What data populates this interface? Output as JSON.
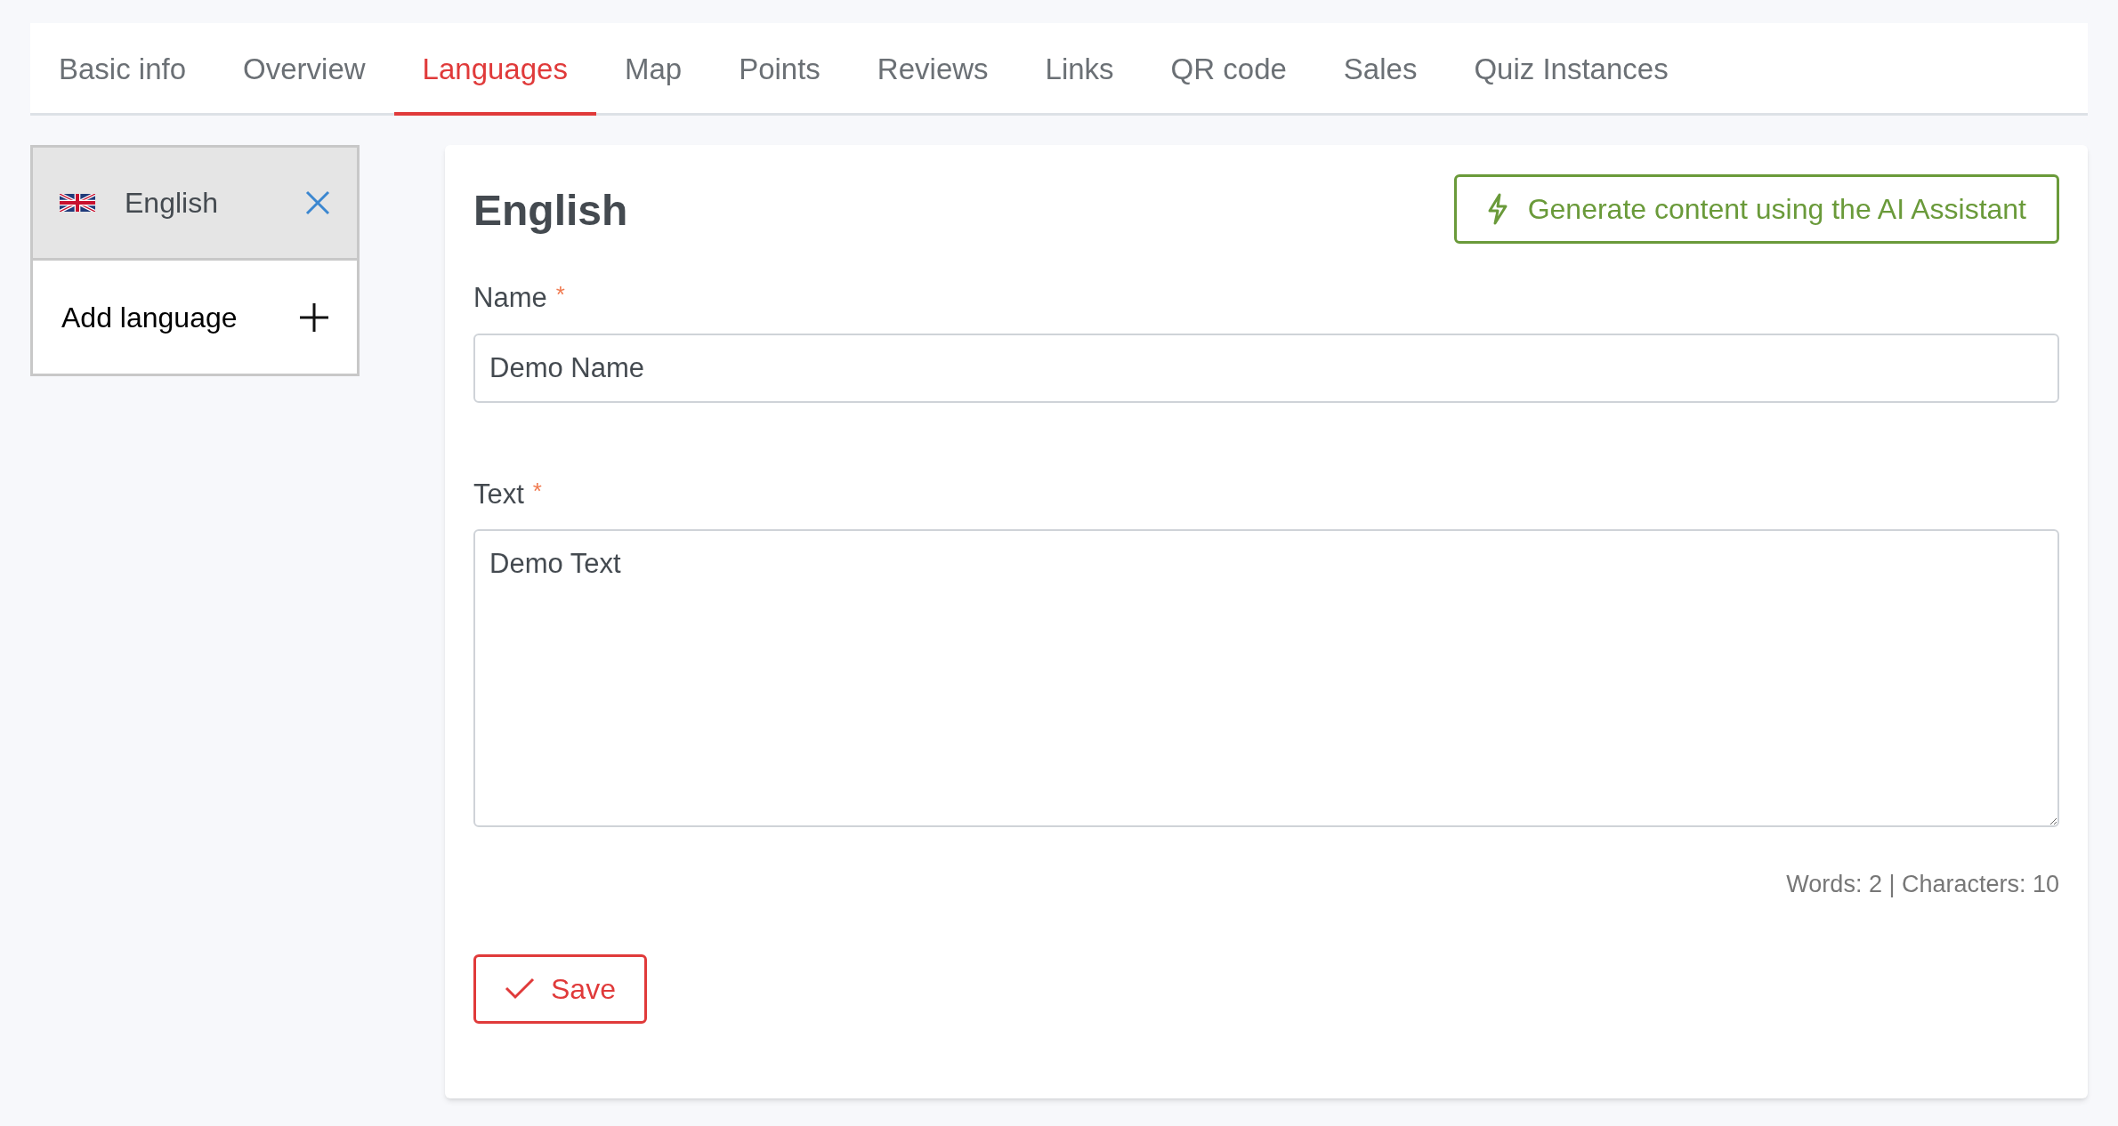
{
  "tabs": [
    {
      "label": "Basic info",
      "selected": false
    },
    {
      "label": "Overview",
      "selected": false
    },
    {
      "label": "Languages",
      "selected": true
    },
    {
      "label": "Map",
      "selected": false
    },
    {
      "label": "Points",
      "selected": false
    },
    {
      "label": "Reviews",
      "selected": false
    },
    {
      "label": "Links",
      "selected": false
    },
    {
      "label": "QR code",
      "selected": false
    },
    {
      "label": "Sales",
      "selected": false
    },
    {
      "label": "Quiz Instances",
      "selected": false
    }
  ],
  "languages": [
    {
      "label": "English",
      "selected": true
    }
  ],
  "add_language": {
    "label": "Add language"
  },
  "editor": {
    "title": "English",
    "ai_button": "Generate content using the AI Assistant",
    "fields": [
      {
        "kind": "input",
        "label": "Name",
        "required": true,
        "value": "Demo Name"
      },
      {
        "kind": "textarea",
        "label": "Text",
        "required": true,
        "value": "Demo Text"
      }
    ],
    "required_mark": "*",
    "counter": "Words: 2 | Characters: 10",
    "save_button": "Save"
  }
}
